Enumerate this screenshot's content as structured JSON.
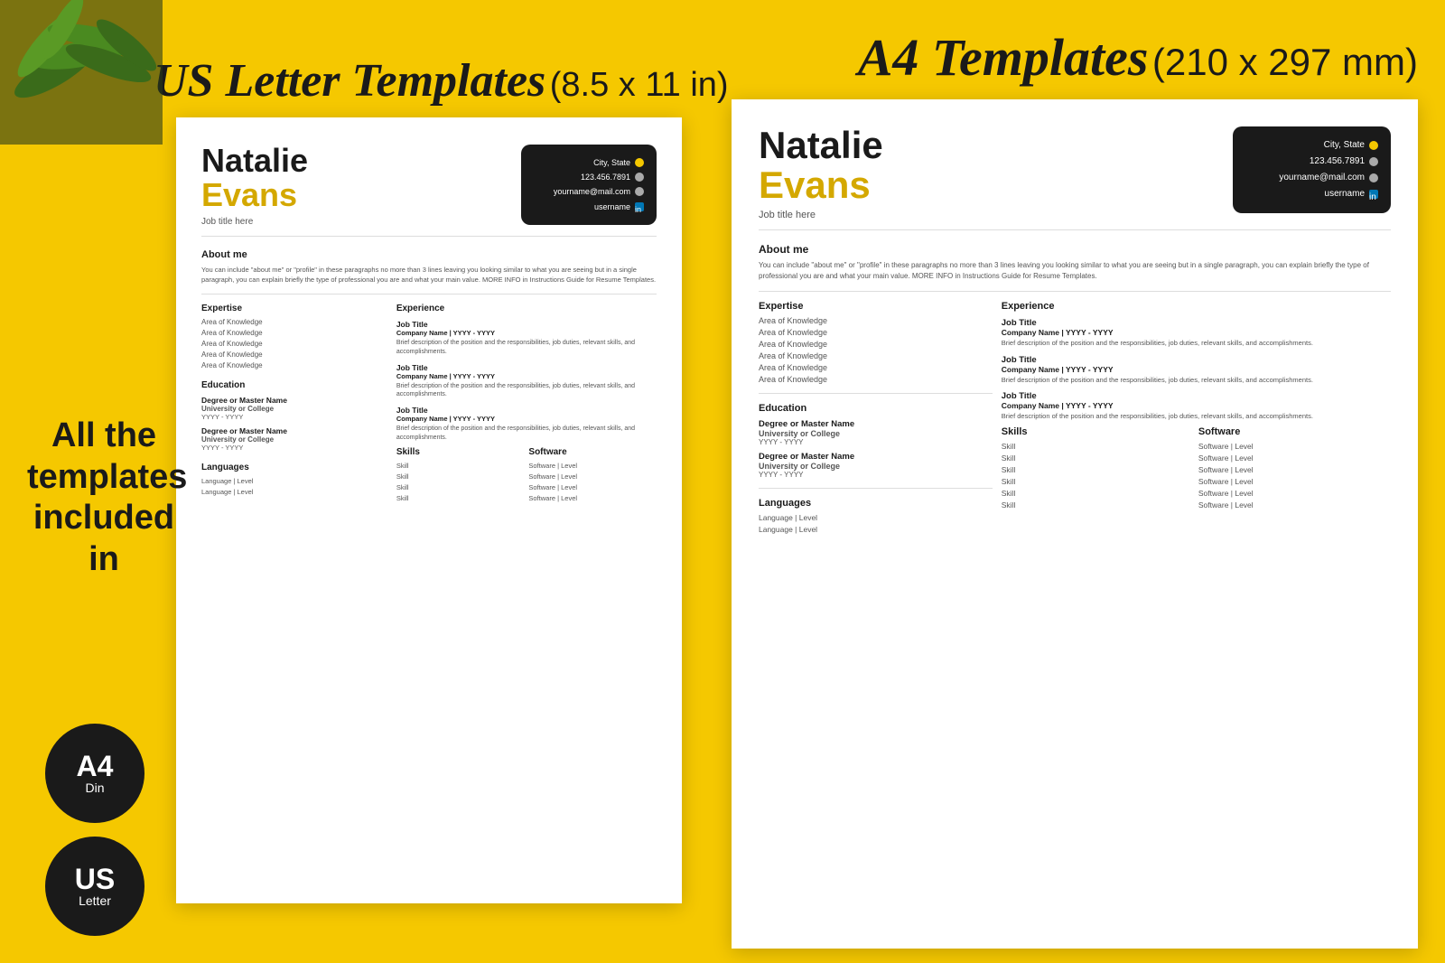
{
  "page": {
    "background_color": "#F5C800",
    "header_left_script": "US Letter Templates",
    "header_left_normal": "(8.5 x 11 in)",
    "header_right_script": "A4 Templates",
    "header_right_normal": "(210 x 297 mm)",
    "side_text": "All the templates included in",
    "badge_a4_title": "A4",
    "badge_a4_sub": "Din",
    "badge_us_title": "US",
    "badge_us_sub": "Letter"
  },
  "resume_us": {
    "name_first": "Natalie",
    "name_last": "Evans",
    "job_title": "Job title here",
    "contact": {
      "city": "City, State",
      "phone": "123.456.7891",
      "email": "yourname@mail.com",
      "username": "username"
    },
    "about_title": "About me",
    "about_text": "You can include \"about me\" or \"profile\" in these paragraphs no more than 3 lines leaving you looking similar to what you are seeing but in a single paragraph, you can explain briefly the type of professional you are and what your main value. MORE INFO in Instructions Guide for Resume Templates.",
    "expertise_title": "Expertise",
    "expertise_items": [
      "Area of Knowledge",
      "Area of Knowledge",
      "Area of Knowledge",
      "Area of Knowledge",
      "Area of Knowledge"
    ],
    "experience_title": "Experience",
    "jobs": [
      {
        "title": "Job Title",
        "company_date": "Company Name | YYYY - YYYY",
        "desc": "Brief description of the position and the responsibilities, job duties, relevant skills, and accomplishments."
      },
      {
        "title": "Job Title",
        "company_date": "Company Name | YYYY - YYYY",
        "desc": "Brief description of the position and the responsibilities, job duties, relevant skills, and accomplishments."
      },
      {
        "title": "Job Title",
        "company_date": "Company Name | YYYY - YYYY",
        "desc": "Brief description of the position and the responsibilities, job duties, relevant skills, and accomplishments."
      }
    ],
    "education_title": "Education",
    "edu_items": [
      {
        "degree": "Degree or Master Name",
        "university": "University or College",
        "year": "YYYY - YYYY"
      },
      {
        "degree": "Degree or Master Name",
        "university": "University or College",
        "year": "YYYY - YYYY"
      }
    ],
    "skills_title": "Skills",
    "skills": [
      "Skill",
      "Skill",
      "Skill",
      "Skill"
    ],
    "software_title": "Software",
    "software_items": [
      "Software | Level",
      "Software | Level",
      "Software | Level",
      "Software | Level"
    ],
    "languages_title": "Languages",
    "languages": [
      "Language | Level",
      "Language | Level"
    ]
  },
  "resume_a4": {
    "name_first": "Natalie",
    "name_last": "Evans",
    "job_title": "Job title here",
    "contact": {
      "city": "City, State",
      "phone": "123.456.7891",
      "email": "yourname@mail.com",
      "username": "username"
    },
    "about_title": "About me",
    "about_text": "You can include \"about me\" or \"profile\" in these paragraphs no more than 3 lines leaving you looking similar to what you are seeing but in a single paragraph, you can explain briefly the type of professional you are and what your main value. MORE INFO in Instructions Guide for Resume Templates.",
    "expertise_title": "Expertise",
    "expertise_items": [
      "Area of Knowledge",
      "Area of Knowledge",
      "Area of Knowledge",
      "Area of Knowledge",
      "Area of Knowledge",
      "Area of Knowledge"
    ],
    "experience_title": "Experience",
    "jobs": [
      {
        "title": "Job Title",
        "company_date": "Company Name | YYYY - YYYY",
        "desc": "Brief description of the position and the responsibilities, job duties, relevant skills, and accomplishments."
      },
      {
        "title": "Job Title",
        "company_date": "Company Name | YYYY - YYYY",
        "desc": "Brief description of the position and the responsibilities, job duties, relevant skills, and accomplishments."
      },
      {
        "title": "Job Title",
        "company_date": "Company Name | YYYY - YYYY",
        "desc": "Brief description of the position and the responsibilities, job duties, relevant skills, and accomplishments."
      }
    ],
    "education_title": "Education",
    "edu_items": [
      {
        "degree": "Degree or Master Name",
        "university": "University or College",
        "year": "YYYY - YYYY"
      },
      {
        "degree": "Degree or Master Name",
        "university": "University or College",
        "year": "YYYY - YYYY"
      }
    ],
    "skills_title": "Skills",
    "skills": [
      "Skill",
      "Skill",
      "Skill",
      "Skill",
      "Skill",
      "Skill"
    ],
    "software_title": "Software",
    "software_items": [
      "Software | Level",
      "Software | Level",
      "Software | Level",
      "Software | Level",
      "Software | Level",
      "Software | Level"
    ],
    "languages_title": "Languages",
    "languages": [
      "Language | Level",
      "Language | Level"
    ]
  }
}
